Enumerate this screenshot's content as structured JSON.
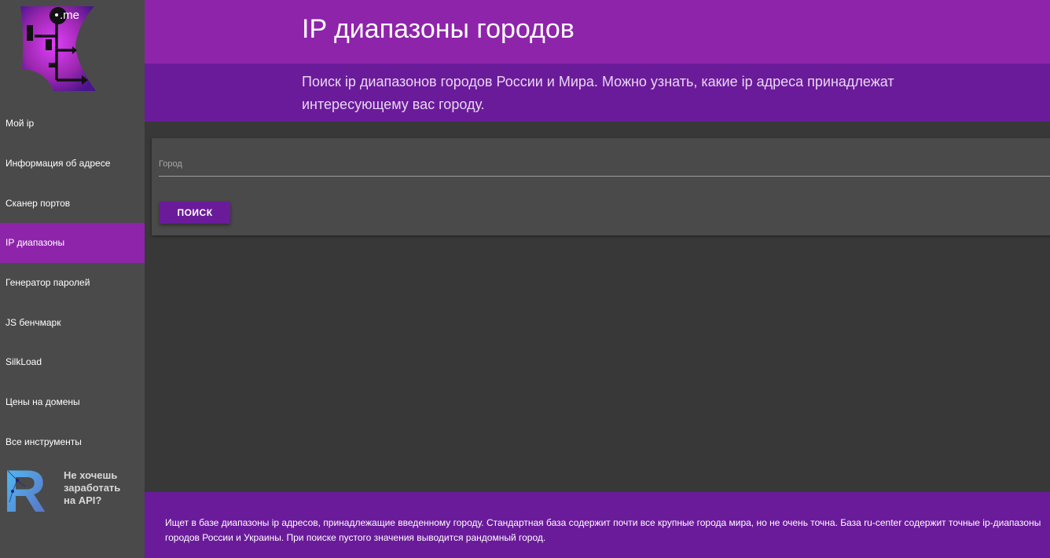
{
  "sidebar": {
    "logo_text": ".me",
    "items": [
      {
        "label": "Мой ip"
      },
      {
        "label": "Информация об адресе"
      },
      {
        "label": "Сканер портов"
      },
      {
        "label": "IP диапазоны"
      },
      {
        "label": "Генератор паролей"
      },
      {
        "label": "JS бенчмарк"
      },
      {
        "label": "SilkLoad"
      },
      {
        "label": "Цены на домены"
      },
      {
        "label": "Все инструменты"
      }
    ],
    "active_index": 3,
    "promo": {
      "text": "Не хочешь заработать на API?",
      "logo_letter": "R"
    }
  },
  "header": {
    "title": "IP диапазоны городов",
    "subtitle": "Поиск ip диапазонов городов России и Мира. Можно узнать, какие ip адреса принадлежат интересующему вас городу."
  },
  "form": {
    "city_placeholder": "Город",
    "city_value": "",
    "search_label": "ПОИСК"
  },
  "footer": {
    "text": "Ищет в базе диапазоны ip адресов, принадлежащие введенному городу. Стандартная база содержит почти все крупные города мира, но не очень точна. База ru-center содержит точные ip-диапазоны городов России и Украины. При поиске пустого значения выводится рандомный город."
  },
  "colors": {
    "accent": "#8e24aa",
    "accent_dark": "#6a1b9a",
    "sidebar_bg": "#4a4a4a",
    "page_bg": "#383838"
  }
}
